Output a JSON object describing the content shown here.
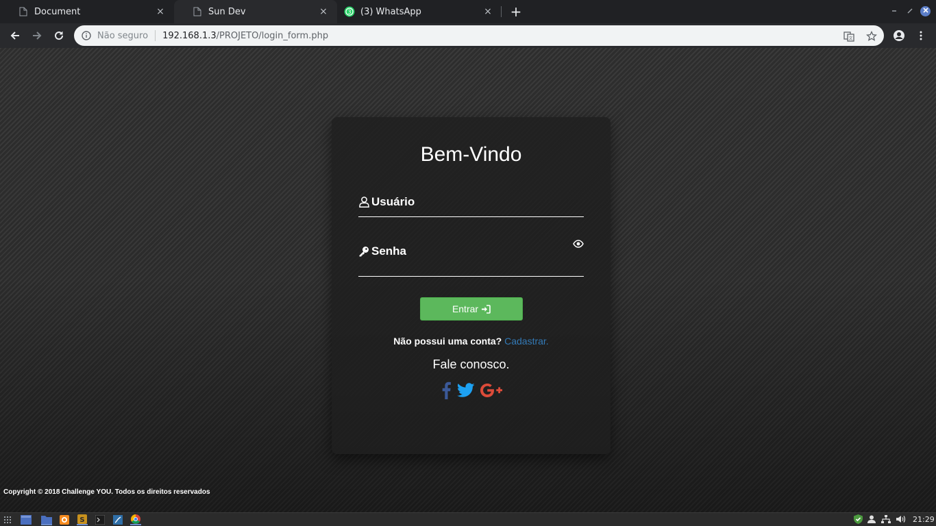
{
  "browser": {
    "tabs": [
      {
        "title": "Document",
        "icon": "document-icon"
      },
      {
        "title": "Sun Dev",
        "icon": "document-icon"
      },
      {
        "title": "(3) WhatsApp",
        "icon": "whatsapp-icon",
        "badge": "3"
      }
    ],
    "close_glyph": "×",
    "new_tab_glyph": "+",
    "address": {
      "security_label": "Não seguro",
      "url_host": "192.168.1.3",
      "url_path": "/PROJETO/login_form.php"
    }
  },
  "login": {
    "title": "Bem-Vindo",
    "username_label": "Usuário",
    "password_label": "Senha",
    "submit_label": "Entrar",
    "signup_prompt": "Não possui uma conta?",
    "signup_link": "Cadastrar.",
    "contact_title": "Fale conosco.",
    "social": [
      "facebook-icon",
      "twitter-icon",
      "google-plus-icon"
    ]
  },
  "footer": {
    "copyright": "Copyright © 2018 Challenge YOU. Todos os direitos reservados"
  },
  "taskbar": {
    "clock": "21:29"
  },
  "colors": {
    "submit_button": "#5cb85c",
    "link": "#337ab7",
    "facebook": "#3b5998",
    "twitter": "#1da1f2",
    "google_plus": "#dd4b39"
  }
}
